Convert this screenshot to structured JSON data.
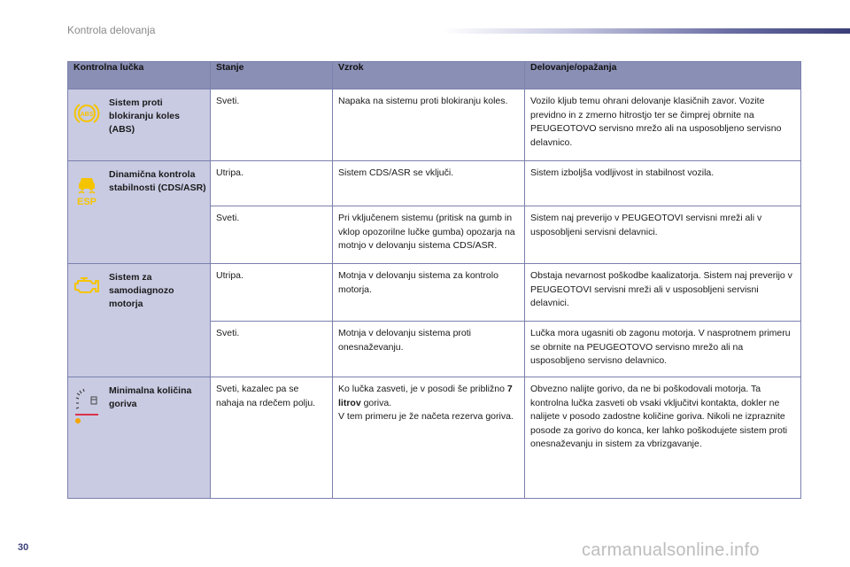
{
  "page": {
    "section_title": "Kontrola delovanja",
    "page_number": "30",
    "watermark": "carmanualsonline.info"
  },
  "colors": {
    "accent": "#3b3f78",
    "header_bg": "#8a8fb5",
    "lamp_col_bg": "#c9cbe3",
    "icon_yellow": "#f5c400",
    "icon_red": "#e2001a"
  },
  "table": {
    "headers": [
      "Kontrolna lučka",
      "Stanje",
      "Vzrok",
      "Delovanje/opažanja"
    ],
    "rows": [
      {
        "lamp": "Sistem proti blokiranju koles (ABS)",
        "icon": "abs-warning-icon",
        "entries": [
          {
            "state": "Sveti.",
            "cause": "Napaka na sistemu proti blokiranju koles.",
            "action": "Vozilo kljub temu ohrani delovanje klasičnih zavor. Vozite previdno in z zmerno hitrostjo ter se čimprej obrnite na PEUGEOTOVO servisno mrežo ali na usposobljeno servisno delavnico."
          }
        ]
      },
      {
        "lamp": "Dinamična kontrola stabilnosti (CDS/ASR)",
        "icon": "esp-stability-icon",
        "icon_label": "ESP",
        "entries": [
          {
            "state": "Utripa.",
            "cause": "Sistem CDS/ASR se vključi.",
            "action": "Sistem izboljša vodljivost in stabilnost vozila."
          },
          {
            "state": "Sveti.",
            "cause": "Pri vključenem sistemu (pritisk na gumb in vklop opozorilne lučke gumba) opozarja na motnjo v delovanju sistema CDS/ASR.",
            "action": "Sistem naj preverijo v PEUGEOTOVI servisni mreži ali v usposobljeni servisni delavnici."
          }
        ]
      },
      {
        "lamp": "Sistem za samodiagnozo motorja",
        "icon": "engine-check-icon",
        "entries": [
          {
            "state": "Utripa.",
            "cause": "Motnja v delovanju sistema za kontrolo motorja.",
            "action": "Obstaja nevarnost poškodbe kaalizatorja. Sistem naj preverijo v PEUGEOTOVI servisni mreži ali v usposobljeni servisni delavnici."
          },
          {
            "state": "Sveti.",
            "cause": "Motnja v delovanju sistema proti onesnaževanju.",
            "action": "Lučka mora ugasniti ob zagonu motorja. V nasprotnem primeru se obrnite na PEUGEOTOVO servisno mrežo ali na usposobljeno servisno delavnico."
          }
        ]
      },
      {
        "lamp": "Minimalna količina goriva",
        "icon": "fuel-gauge-icon",
        "entries": [
          {
            "state": "Sveti, kazalec pa se nahaja na rdečem polju.",
            "cause_pre": "Ko lučka zasveti, je v posodi še približno",
            "cause_bold": "7 litrov",
            "cause_post": "goriva.",
            "cause_2": "V tem primeru je že načeta rezerva goriva.",
            "action": "Obvezno nalijte gorivo, da ne bi poškodovali motorja. Ta kontrolna lučka zasveti ob vsaki vključitvi kontakta, dokler ne nalijete v posodo zadostne količine goriva. Nikoli ne izpraznite posode za gorivo do konca, ker lahko poškodujete sistem proti onesnaževanju in sistem za vbrizgavanje."
          }
        ]
      }
    ]
  }
}
